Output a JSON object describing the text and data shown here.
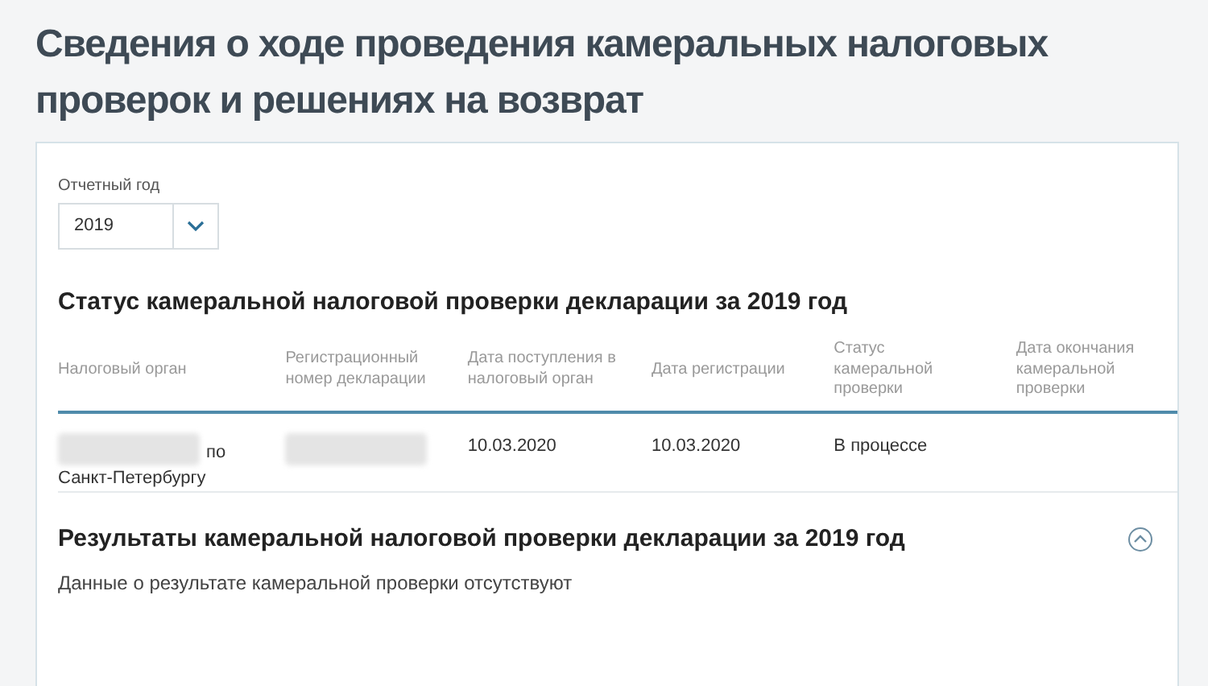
{
  "page_title": "Сведения о ходе проведения камеральных налоговых проверок и решениях на возврат",
  "year_field": {
    "label": "Отчетный год",
    "value": "2019"
  },
  "status_section": {
    "title": "Статус камеральной налоговой проверки декларации за 2019 год",
    "columns": [
      "Налоговый орган",
      "Регистрационный номер декларации",
      "Дата поступления в налоговый орган",
      "Дата регистрации",
      "Статус камеральной проверки",
      "Дата окончания камеральной проверки"
    ],
    "rows": [
      {
        "cells": [
          {
            "redacted": true,
            "lines": [
              "по",
              "Санкт-Петербургу"
            ]
          },
          {
            "redacted": true
          },
          {
            "redacted": false,
            "lines": [
              "10.03.2020"
            ]
          },
          {
            "redacted": false,
            "lines": [
              "10.03.2020"
            ]
          },
          {
            "redacted": false,
            "lines": [
              "В процессе"
            ]
          },
          {
            "redacted": false
          }
        ]
      }
    ]
  },
  "results_section": {
    "title": "Результаты камеральной налоговой проверки декларации за 2019 год",
    "expanded": true,
    "message": "Данные о результате камеральной проверки отсутствуют"
  }
}
